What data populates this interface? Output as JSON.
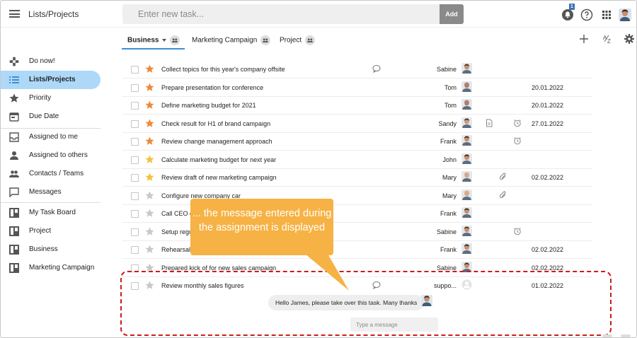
{
  "header": {
    "app_title": "Lists/Projects",
    "task_placeholder": "Enter new task...",
    "add_label": "Add",
    "notification_count": "1"
  },
  "sidebar": {
    "items": [
      {
        "label": "Do now!",
        "icon": "gamepad-icon"
      },
      {
        "label": "Lists/Projects",
        "icon": "list-icon",
        "active": true
      },
      {
        "label": "Priority",
        "icon": "star-icon"
      },
      {
        "label": "Due Date",
        "icon": "calendar-icon"
      },
      {
        "label": "Assigned to me",
        "icon": "inbox-icon"
      },
      {
        "label": "Assigned to others",
        "icon": "person-icon"
      },
      {
        "label": "Contacts / Teams",
        "icon": "group-icon"
      },
      {
        "label": "Messages",
        "icon": "chat-icon"
      },
      {
        "label": "My Task Board",
        "icon": "board-icon"
      },
      {
        "label": "Project",
        "icon": "board-icon"
      },
      {
        "label": "Business",
        "icon": "board-icon"
      },
      {
        "label": "Marketing Campaign",
        "icon": "board-icon"
      }
    ]
  },
  "tabs": [
    {
      "label": "Business",
      "active": true
    },
    {
      "label": "Marketing Campaign"
    },
    {
      "label": "Project"
    }
  ],
  "tasks": [
    {
      "title": "Collect topics for this year's company offsite",
      "owner": "Sabine",
      "star": "orange",
      "date": "",
      "comment": true
    },
    {
      "title": "Prepare presentation for conference",
      "owner": "Tom",
      "star": "orange",
      "date": "20.01.2022"
    },
    {
      "title": "Define marketing budget for 2021",
      "owner": "Tom",
      "star": "orange",
      "date": "20.01.2022"
    },
    {
      "title": "Check result for H1 of brand campaign",
      "owner": "Sandy",
      "star": "orange",
      "date": "27.01.2022",
      "note": true,
      "alarm": true
    },
    {
      "title": "Review change management approach",
      "owner": "Frank",
      "star": "orange",
      "date": "",
      "alarm": true
    },
    {
      "title": "Calculate marketing budget for next year",
      "owner": "John",
      "star": "yellow",
      "date": ""
    },
    {
      "title": "Review draft of new marketing campaign",
      "owner": "Mary",
      "star": "yellow",
      "date": "02.02.2022",
      "attach": true
    },
    {
      "title": "Configure new company car",
      "owner": "Mary",
      "star": "grey",
      "date": "",
      "attach": true
    },
    {
      "title": "Call CEO c",
      "owner": "Frank",
      "star": "grey",
      "date": ""
    },
    {
      "title": "Setup regu",
      "owner": "Sabine",
      "star": "grey",
      "date": "",
      "alarm": true
    },
    {
      "title": "Rehearsal",
      "owner": "Frank",
      "star": "grey",
      "date": "02.02.2022"
    },
    {
      "title": "Prepared kick of for new sales campaign",
      "owner": "Sabine",
      "star": "grey",
      "date": "02.02.2022"
    },
    {
      "title": "Review monthly sales figures",
      "owner": "suppo...",
      "star": "grey",
      "date": "01.02.2022",
      "comment": true,
      "placeholder_avatar": true
    }
  ],
  "message": {
    "text": "Hello James, please take over this task. Many thanks",
    "input_placeholder": "Type a message"
  },
  "callout": {
    "text": "... the message entered during the assignment is displayed"
  },
  "colors": {
    "accent": "#3d8ed8",
    "sidebar_active": "#aed8f7",
    "callout": "#f6b244",
    "annotation_border": "#cc1b1b",
    "star_orange": "#ec8a3c",
    "star_yellow": "#f2c33c",
    "star_grey": "#c8c8c8"
  }
}
